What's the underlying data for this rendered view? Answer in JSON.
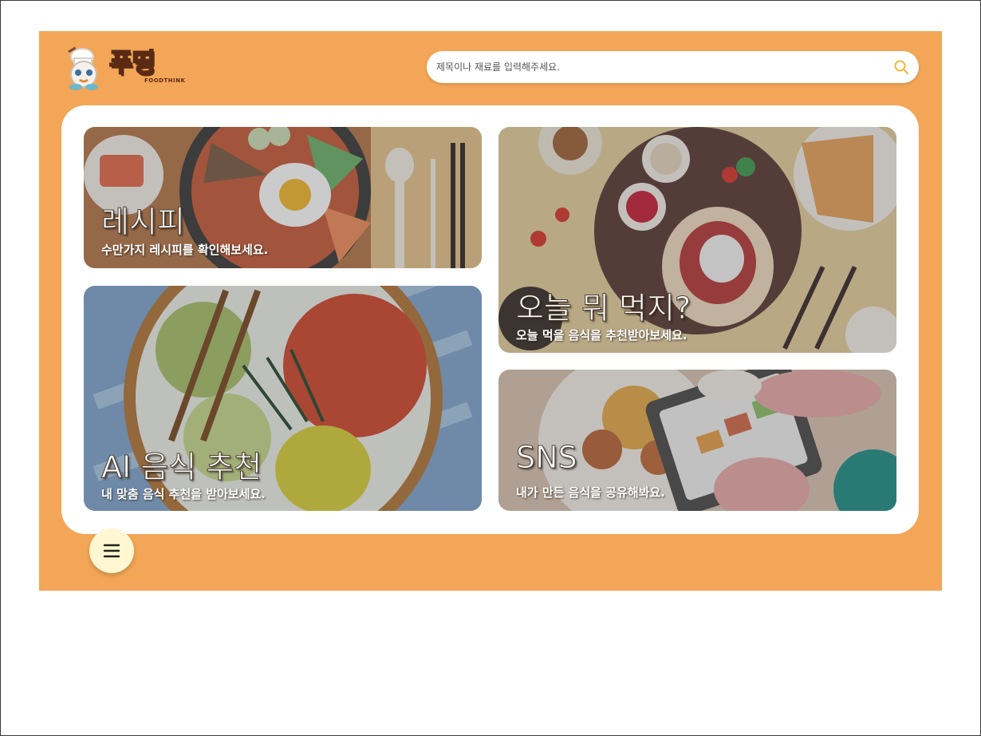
{
  "brand": {
    "name": "푸띵",
    "subtitle": "FOODTHINK"
  },
  "search": {
    "placeholder": "제목이나 재료를 입력해주세요.",
    "icon": "search-icon"
  },
  "cards": {
    "recipe": {
      "title": "레시피",
      "subtitle": "수만가지 레시피를 확인해보세요."
    },
    "today": {
      "title": "오늘 뭐 먹지?",
      "subtitle": "오늘 먹을 음식을 추천받아보세요."
    },
    "ai": {
      "title": "AI 음식 추천",
      "subtitle": "내 맞춤 음식 추천을 받아보세요."
    },
    "sns": {
      "title": "SNS",
      "subtitle": "내가 만든 음식을 공유해봐요."
    }
  },
  "menu": {
    "icon": "hamburger-menu-icon"
  },
  "colors": {
    "background": "#f3a657",
    "panel": "#ffffff",
    "search_icon": "#f3b83a",
    "menu_button": "#fff7d1"
  }
}
